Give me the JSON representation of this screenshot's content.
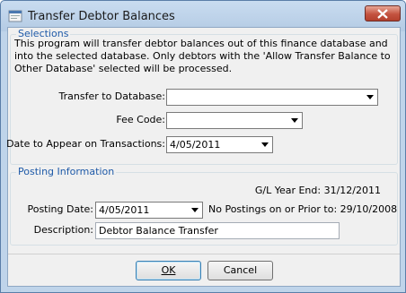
{
  "window": {
    "title": "Transfer Debtor Balances"
  },
  "selections": {
    "legend": "Selections",
    "description": "This program will transfer debtor balances out of this finance database and into the selected database.  Only debtors with the 'Allow Transfer Balance to Other Database' selected will be processed.",
    "transfer_to_database": {
      "label": "Transfer to Database:",
      "value": ""
    },
    "fee_code": {
      "label": "Fee Code:",
      "value": ""
    },
    "date_to_appear": {
      "label": "Date to Appear on Transactions:",
      "value": "4/05/2011"
    }
  },
  "posting": {
    "legend": "Posting Information",
    "gl_year_end": "G/L Year End: 31/12/2011",
    "posting_date": {
      "label": "Posting Date:",
      "value": "4/05/2011"
    },
    "no_postings_note": "No Postings on or Prior to: 29/10/2008",
    "description": {
      "label": "Description:",
      "value": "Debtor Balance Transfer"
    }
  },
  "buttons": {
    "ok": "OK",
    "cancel": "Cancel"
  }
}
